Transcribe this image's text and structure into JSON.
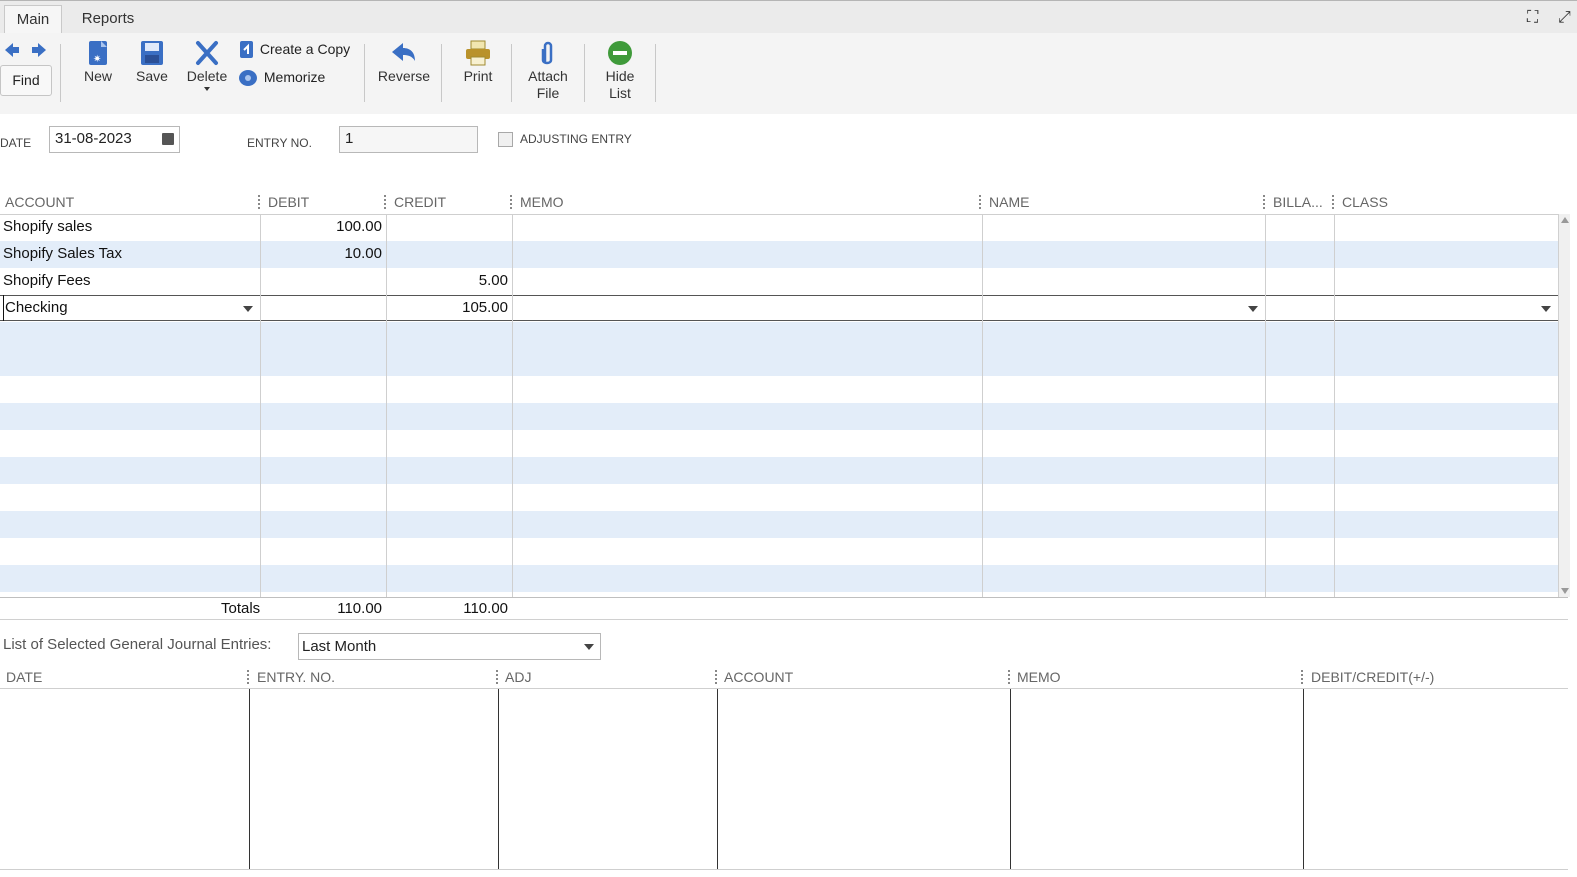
{
  "tabs": [
    {
      "label": "Main",
      "active": true
    },
    {
      "label": "Reports",
      "active": false
    }
  ],
  "toolbar": {
    "find_label": "Find",
    "new_label": "New",
    "save_label": "Save",
    "delete_label": "Delete",
    "create_copy_label": "Create a Copy",
    "memorize_label": "Memorize",
    "reverse_label": "Reverse",
    "print_label": "Print",
    "attach_label_1": "Attach",
    "attach_label_2": "File",
    "hide_label_1": "Hide",
    "hide_label_2": "List"
  },
  "form": {
    "date_label": "DATE",
    "date_value": "31-08-2023",
    "entry_no_label": "ENTRY NO.",
    "entry_no_value": "1",
    "adjusting_label": "ADJUSTING ENTRY"
  },
  "grid": {
    "headers": {
      "account": "ACCOUNT",
      "debit": "DEBIT",
      "credit": "CREDIT",
      "memo": "MEMO",
      "name": "NAME",
      "billable": "BILLA...",
      "class": "CLASS"
    },
    "rows": [
      {
        "account": "Shopify sales",
        "debit": "100.00",
        "credit": ""
      },
      {
        "account": "Shopify Sales Tax",
        "debit": "10.00",
        "credit": ""
      },
      {
        "account": "Shopify Fees",
        "debit": "",
        "credit": "5.00"
      },
      {
        "account": "Checking",
        "debit": "",
        "credit": "105.00"
      }
    ],
    "totals_label": "Totals",
    "total_debit": "110.00",
    "total_credit": "110.00"
  },
  "list": {
    "label": "List of Selected General Journal Entries:",
    "filter_value": "Last Month",
    "headers": {
      "date": "DATE",
      "entry_no": "ENTRY. NO.",
      "adj": "ADJ",
      "account": "ACCOUNT",
      "memo": "MEMO",
      "debit_credit": "DEBIT/CREDIT(+/-)"
    }
  },
  "colors": {
    "row_alt": "#e3edf9",
    "toolbar_bg": "#f4f4f4",
    "icon_blue": "#3a6fc4",
    "icon_green": "#3f9a3a"
  }
}
